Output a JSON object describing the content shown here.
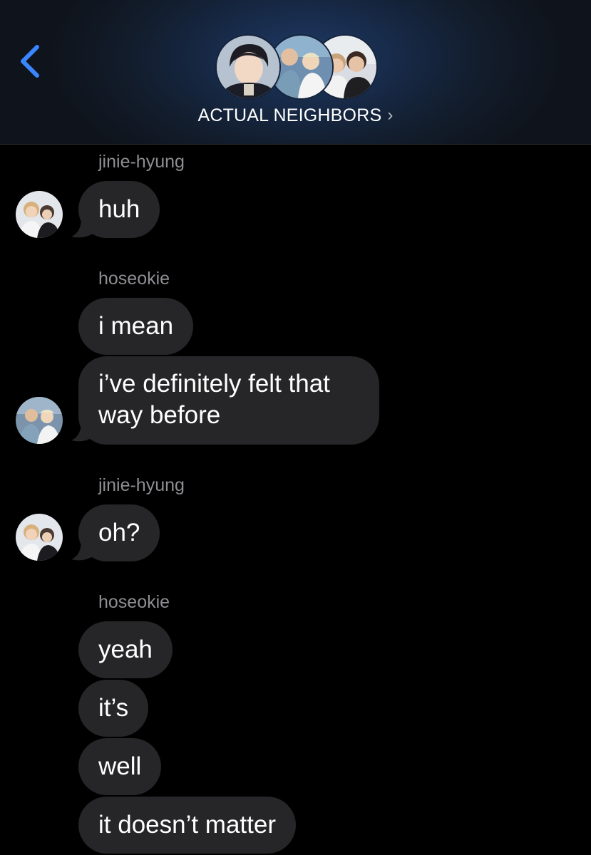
{
  "header": {
    "back_icon": "chevron-left-icon",
    "group_name": "ACTUAL NEIGHBORS",
    "chevron": "›",
    "accent_color": "#3a86ff"
  },
  "messages": [
    {
      "sender": "jinie-hyung",
      "text": "huh"
    },
    {
      "sender": "hoseokie",
      "text": "i mean"
    },
    {
      "text": "i’ve definitely felt that way before"
    },
    {
      "sender": "jinie-hyung",
      "text": "oh?"
    },
    {
      "sender": "hoseokie",
      "text": "yeah"
    },
    {
      "text": "it’s"
    },
    {
      "text": "well"
    },
    {
      "text": "it doesn’t matter"
    }
  ],
  "colors": {
    "bubble": "#262628",
    "sender_label": "#8e8e93",
    "background": "#000000"
  }
}
